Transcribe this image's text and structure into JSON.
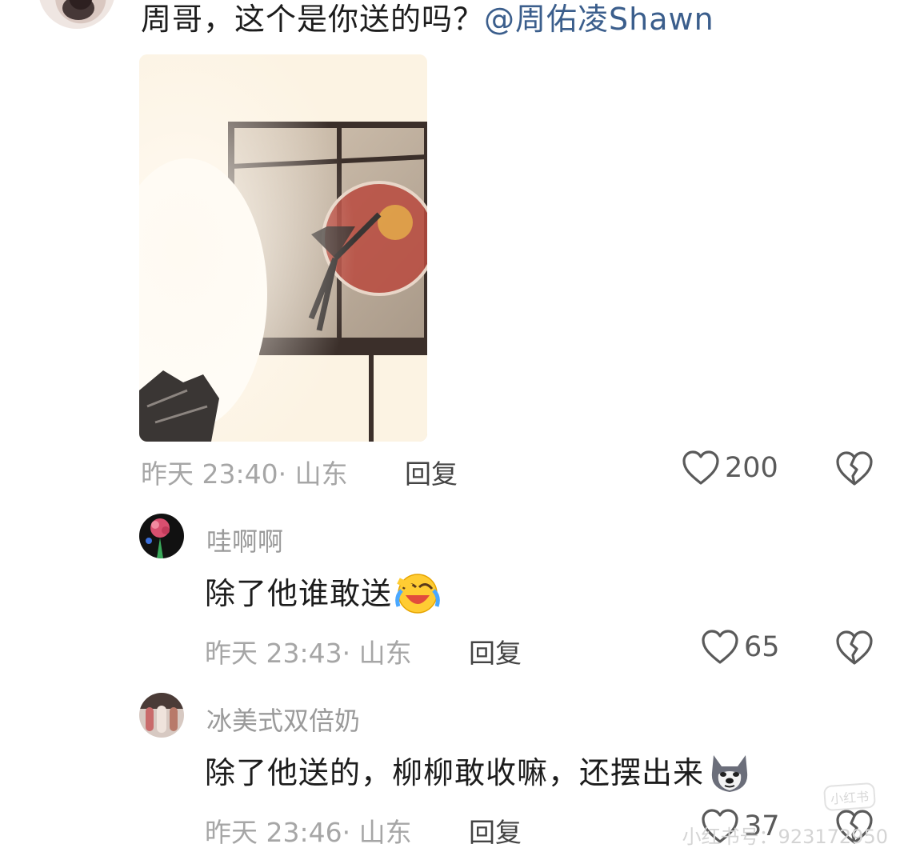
{
  "top_comment": {
    "text": "周哥，这个是你送的吗？",
    "mention": "@周佑凌Shawn",
    "meta": "昨天 23:40· 山东",
    "reply_label": "回复",
    "likes": "200"
  },
  "replies": [
    {
      "username": "哇啊啊",
      "text": "除了他谁敢送",
      "emoji": "laughing-crying-emoji",
      "meta": "昨天 23:43· 山东",
      "reply_label": "回复",
      "likes": "65"
    },
    {
      "username": "冰美式双倍奶",
      "text": "除了他送的，柳柳敢收嘛，还摆出来",
      "emoji": "doge-emoji",
      "meta": "昨天 23:46· 山东",
      "reply_label": "回复",
      "likes": "37"
    }
  ],
  "icons": {
    "like": "heart-outline-icon",
    "dislike": "broken-heart-icon"
  },
  "watermark": {
    "text": "小红书号：923172950",
    "badge": "小红书"
  },
  "colors": {
    "mention": "#3b5e8c",
    "meta": "#a6a6a6",
    "icon": "#5a5a5a"
  }
}
